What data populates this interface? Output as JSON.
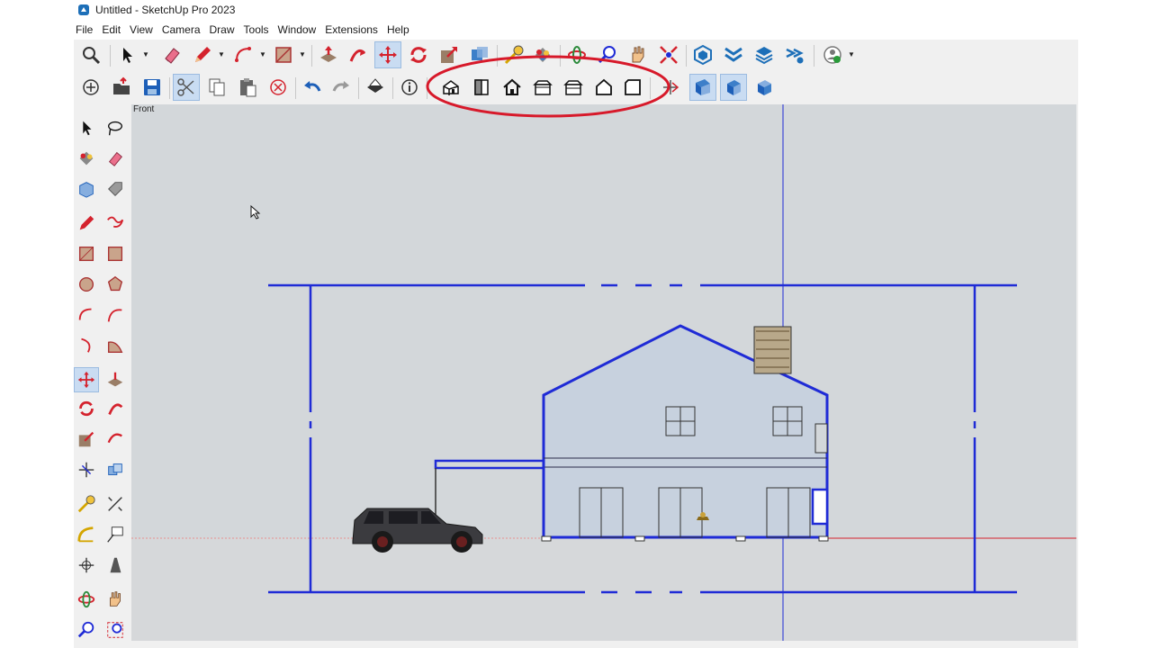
{
  "window": {
    "title": "Untitled - SketchUp Pro 2023"
  },
  "menu": [
    "File",
    "Edit",
    "View",
    "Camera",
    "Draw",
    "Tools",
    "Window",
    "Extensions",
    "Help"
  ],
  "viewport": {
    "scene_label": "Front"
  },
  "colors": {
    "accent": "#1f2bd6",
    "annotation": "#d7192a",
    "sky": "#d3d7da",
    "ground": "#d6d8da",
    "house_fill": "#c7d1de"
  }
}
